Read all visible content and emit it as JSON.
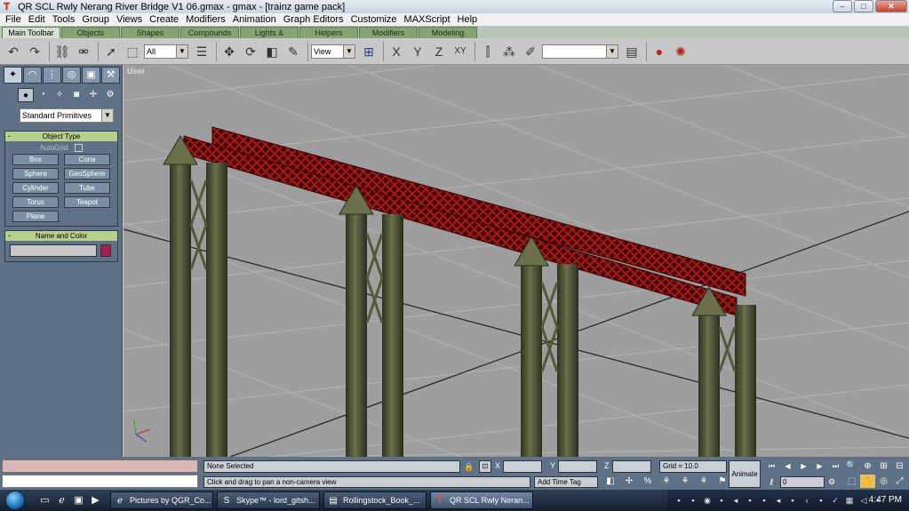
{
  "window": {
    "title": "QR SCL Rwly Nerang River Bridge V1 06.gmax - gmax - [trainz game pack]",
    "minimize": "–",
    "maximize": "□",
    "close": "✕"
  },
  "menu": [
    "File",
    "Edit",
    "Tools",
    "Group",
    "Views",
    "Create",
    "Modifiers",
    "Animation",
    "Graph Editors",
    "Customize",
    "MAXScript",
    "Help"
  ],
  "tabs": [
    "Main Toolbar",
    "Objects",
    "Shapes",
    "Compounds",
    "Lights & Cameras",
    "Helpers",
    "Modifiers",
    "Modeling"
  ],
  "toolbar": {
    "selection_filter": "All",
    "coord_system": "View",
    "named_selection": ""
  },
  "command_panel": {
    "category": "Standard Primitives",
    "object_type": {
      "title": "Object Type",
      "autogrid": "AutoGrid",
      "buttons": [
        "Box",
        "Cone",
        "Sphere",
        "GeoSphere",
        "Cylinder",
        "Tube",
        "Torus",
        "Teapot",
        "Plane"
      ]
    },
    "name_color": {
      "title": "Name and Color",
      "name": "",
      "color": "#a51e4d"
    }
  },
  "viewport": {
    "label": "User",
    "background": "#9e9e9e",
    "truss_color": "#7a1010",
    "pier_color": "#4f5236"
  },
  "status": {
    "selection": "None Selected",
    "prompt": "Click and drag to pan a non-camera view",
    "x_label": "X",
    "y_label": "Y",
    "z_label": "Z",
    "x": "",
    "y": "",
    "z": "",
    "grid": "Grid = 10.0",
    "add_time_tag": "Add Time Tag",
    "animate": "Animate",
    "frame": "0"
  },
  "taskbar": {
    "tasks": [
      {
        "label": "Pictures by QGR_Co...",
        "icon": "ie-icon"
      },
      {
        "label": "Skype™ - lord_gitsh...",
        "icon": "skype-icon"
      },
      {
        "label": "Rollingstock_Book_...",
        "icon": "pdf-icon"
      },
      {
        "label": "QR SCL Rwly Neran...",
        "icon": "gmax-icon"
      }
    ],
    "clock": "4:47 PM"
  }
}
